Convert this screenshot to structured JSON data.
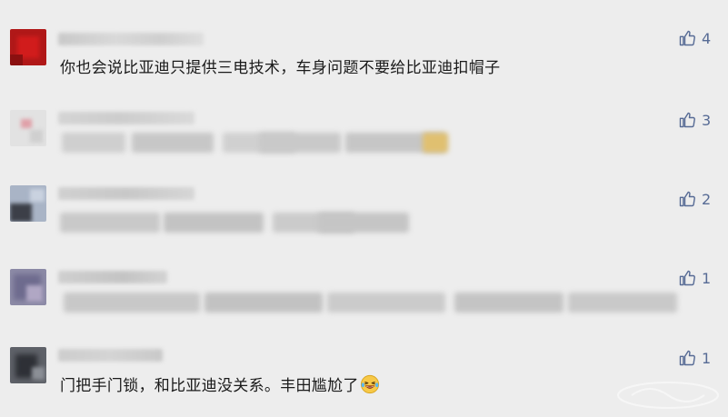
{
  "comments": [
    {
      "text": "你也会说比亚迪只提供三电技术，车身问题不要给比亚迪扣帽子",
      "likes": "4"
    },
    {
      "text": "",
      "likes": "3"
    },
    {
      "text": "",
      "likes": "2"
    },
    {
      "text": "",
      "likes": "1"
    },
    {
      "text": "门把手门锁，和比亚迪没关系。丰田尴尬了",
      "likes": "1"
    }
  ],
  "icons": {
    "like": "thumbs-up-icon",
    "emoji": "laughing-tears-emoji-icon"
  },
  "colors": {
    "background": "#ededed",
    "like_accent": "#576b95",
    "text": "#1a1a1a"
  }
}
